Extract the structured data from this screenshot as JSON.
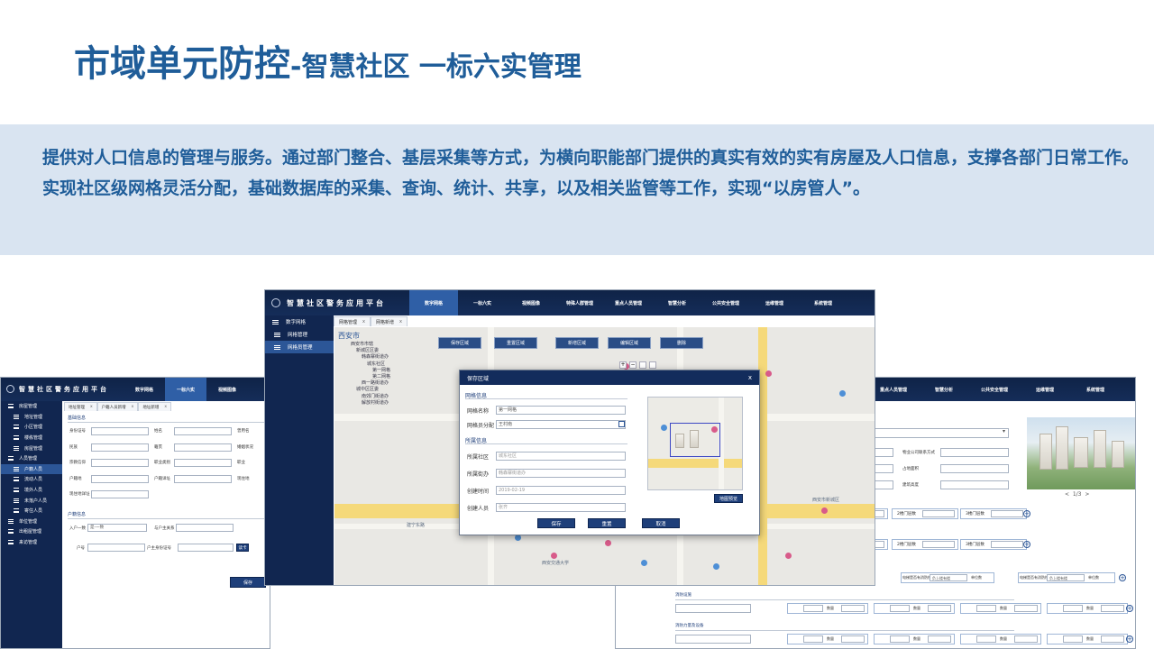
{
  "slide": {
    "title_main": "市域单元防控",
    "title_sub": "-智慧社区 一标六实管理",
    "para1": "提供对人口信息的管理与服务。通过部门整合、基层采集等方式，为横向职能部门提供的真实有效的实有房屋及人口信息，支撑各部门日常工作。",
    "para2": "实现社区级网格灵活分配，基础数据库的采集、查询、统计、共享，以及相关监管等工作，实现“以房管人”。"
  },
  "left_screen": {
    "brand": "智慧社区警务应用平台",
    "nav": [
      "数字网格",
      "一标六实",
      "视频图像"
    ],
    "nav_active_index": 1,
    "sidebar": [
      "房屋管理",
      "地址管理",
      "小区管理",
      "楼栋管理",
      "房屋管理",
      "人员管理",
      "户籍人员",
      "流动人员",
      "境外人员",
      "未落户人员",
      "寄住人员",
      "单位管理",
      "出租屋管理",
      "来访管理"
    ],
    "sidebar_active_index": 6,
    "tabs": [
      "地址管理",
      "户籍人员新增",
      "地址新增"
    ],
    "section1": "基础信息",
    "section2": "户籍信息",
    "fields": [
      "身份证号",
      "姓名",
      "曾用名",
      "民族",
      "籍贯",
      "婚姻状况",
      "宗教信仰",
      "职业类别",
      "职业",
      "户籍地",
      "户籍详址",
      "现住地",
      "现住地详址"
    ],
    "fields2": [
      "入户一致",
      "与户主关系",
      "户号",
      "户主身份证号"
    ],
    "same_value": "是-一致",
    "read_card": "读卡",
    "save": "保存"
  },
  "center_screen": {
    "brand": "智慧社区警务应用平台",
    "nav": [
      "数字网格",
      "一标六实",
      "视频图像",
      "特殊人群管理",
      "重点人员管理",
      "智慧分析",
      "公共安全管理",
      "运维管理",
      "系统管理"
    ],
    "nav_active_index": 0,
    "sidebar": [
      "数字网格",
      "网格管理",
      "网格员管理"
    ],
    "sidebar_active_index": 2,
    "tabs": [
      "网格管理",
      "网格新增"
    ],
    "map_city": "西安市",
    "tree": [
      "西安市市辖",
      "新城区区委",
      "韩森寨街道办",
      "城东社区",
      "第一网格",
      "第二网格",
      "西一路街道办",
      "城中区区委",
      "南郊门街道办",
      "解放村街道办"
    ],
    "map_buttons": [
      "保存区域",
      "重置区域",
      "新增区域",
      "编辑区域",
      "删除"
    ]
  },
  "modal": {
    "title": "保存区域",
    "close": "x",
    "section1": "网格信息",
    "label_name": "网格名称",
    "value_name": "第一网格",
    "label_staff": "网格员分配",
    "value_staff": "王村南",
    "section2": "所属信息",
    "label_community": "所属社区",
    "value_community": "城东社区",
    "label_street": "所属街办",
    "value_street": "韩森寨街道办",
    "label_created": "创建时间",
    "value_created": "2019-02-19",
    "label_creator": "创建人员",
    "value_creator": "张齐",
    "map_preview_btn": "地图预览",
    "buttons": [
      "保存",
      "重置",
      "取消"
    ]
  },
  "right_screen": {
    "nav": [
      "重点人员管理",
      "智慧分析",
      "公共安全管理",
      "运维管理",
      "系统管理"
    ],
    "fields": [
      "物业公司联系方式",
      "占地面积",
      "建筑高度"
    ],
    "pager": "1/3",
    "room_labels": [
      "1楼门层数",
      "2楼门层数",
      "3楼门层数",
      "1楼门层数",
      "2楼门层数",
      "3楼门层数"
    ],
    "elev_label": "电梯是否有消防栓",
    "elev_value": "负上楼有楼",
    "units_label": "单位数",
    "section_a": "消防设施",
    "section_b": "消防力量及设备",
    "qty": "数量"
  }
}
